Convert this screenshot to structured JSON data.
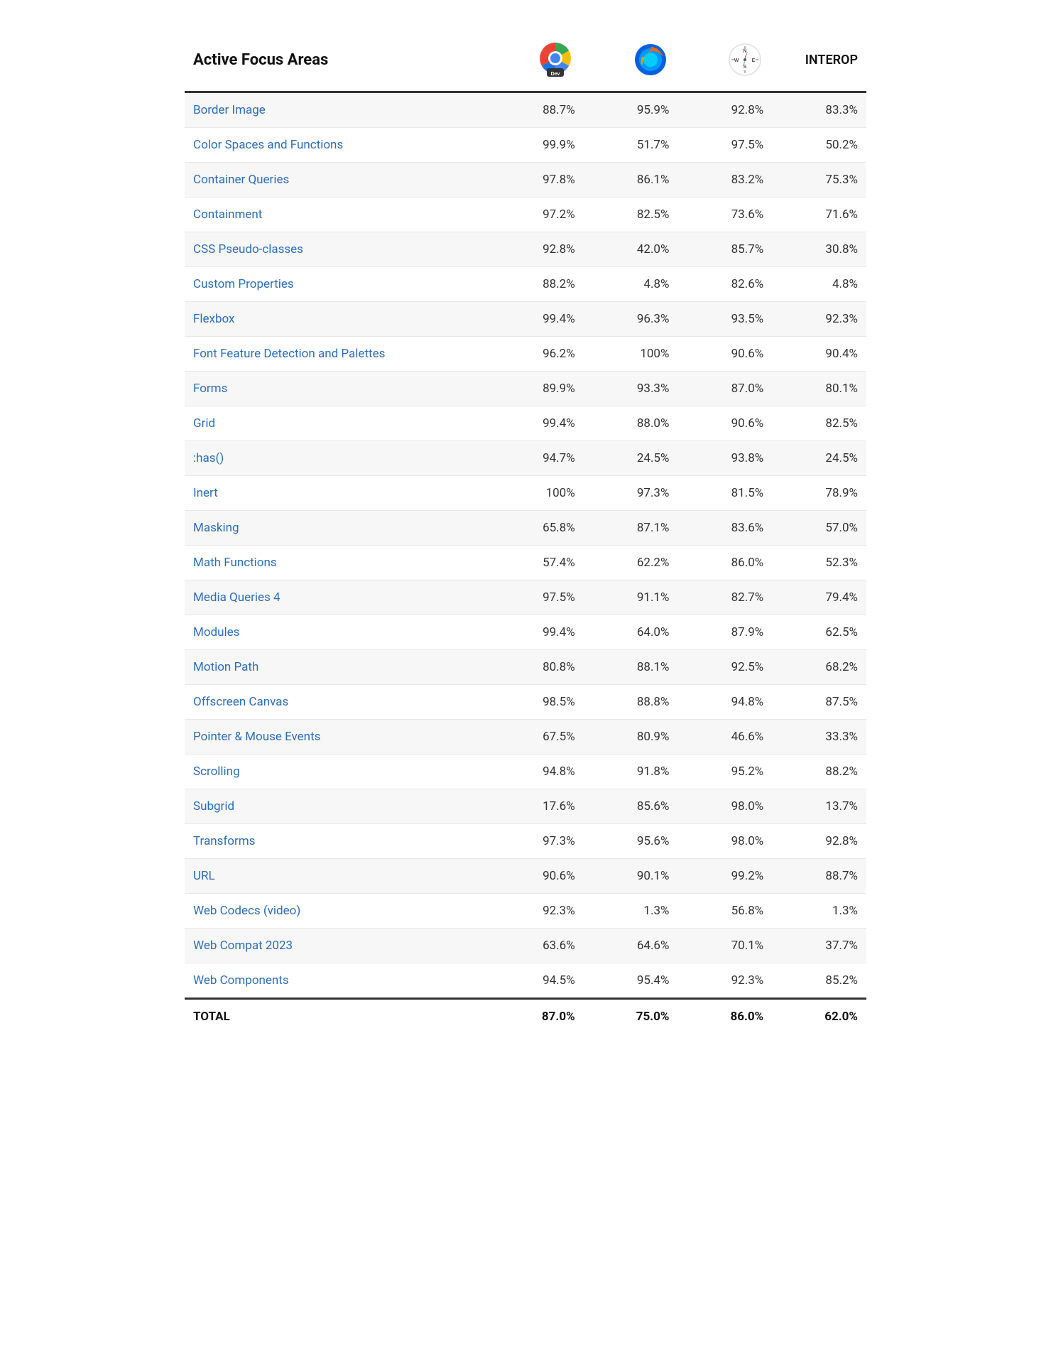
{
  "header": {
    "area_label": "Active Focus Areas",
    "interop_label": "INTEROP"
  },
  "browsers": {
    "chrome_dev_label": "Chrome Dev",
    "firefox_label": "Firefox",
    "safari_label": "Safari"
  },
  "rows": [
    {
      "name": "Border Image",
      "chrome": "88.7%",
      "firefox": "95.9%",
      "safari": "92.8%",
      "interop": "83.3%"
    },
    {
      "name": "Color Spaces and Functions",
      "chrome": "99.9%",
      "firefox": "51.7%",
      "safari": "97.5%",
      "interop": "50.2%"
    },
    {
      "name": "Container Queries",
      "chrome": "97.8%",
      "firefox": "86.1%",
      "safari": "83.2%",
      "interop": "75.3%"
    },
    {
      "name": "Containment",
      "chrome": "97.2%",
      "firefox": "82.5%",
      "safari": "73.6%",
      "interop": "71.6%"
    },
    {
      "name": "CSS Pseudo-classes",
      "chrome": "92.8%",
      "firefox": "42.0%",
      "safari": "85.7%",
      "interop": "30.8%"
    },
    {
      "name": "Custom Properties",
      "chrome": "88.2%",
      "firefox": "4.8%",
      "safari": "82.6%",
      "interop": "4.8%"
    },
    {
      "name": "Flexbox",
      "chrome": "99.4%",
      "firefox": "96.3%",
      "safari": "93.5%",
      "interop": "92.3%"
    },
    {
      "name": "Font Feature Detection and Palettes",
      "chrome": "96.2%",
      "firefox": "100%",
      "safari": "90.6%",
      "interop": "90.4%"
    },
    {
      "name": "Forms",
      "chrome": "89.9%",
      "firefox": "93.3%",
      "safari": "87.0%",
      "interop": "80.1%"
    },
    {
      "name": "Grid",
      "chrome": "99.4%",
      "firefox": "88.0%",
      "safari": "90.6%",
      "interop": "82.5%"
    },
    {
      "name": ":has()",
      "chrome": "94.7%",
      "firefox": "24.5%",
      "safari": "93.8%",
      "interop": "24.5%"
    },
    {
      "name": "Inert",
      "chrome": "100%",
      "firefox": "97.3%",
      "safari": "81.5%",
      "interop": "78.9%"
    },
    {
      "name": "Masking",
      "chrome": "65.8%",
      "firefox": "87.1%",
      "safari": "83.6%",
      "interop": "57.0%"
    },
    {
      "name": "Math Functions",
      "chrome": "57.4%",
      "firefox": "62.2%",
      "safari": "86.0%",
      "interop": "52.3%"
    },
    {
      "name": "Media Queries 4",
      "chrome": "97.5%",
      "firefox": "91.1%",
      "safari": "82.7%",
      "interop": "79.4%"
    },
    {
      "name": "Modules",
      "chrome": "99.4%",
      "firefox": "64.0%",
      "safari": "87.9%",
      "interop": "62.5%"
    },
    {
      "name": "Motion Path",
      "chrome": "80.8%",
      "firefox": "88.1%",
      "safari": "92.5%",
      "interop": "68.2%"
    },
    {
      "name": "Offscreen Canvas",
      "chrome": "98.5%",
      "firefox": "88.8%",
      "safari": "94.8%",
      "interop": "87.5%"
    },
    {
      "name": "Pointer & Mouse Events",
      "chrome": "67.5%",
      "firefox": "80.9%",
      "safari": "46.6%",
      "interop": "33.3%"
    },
    {
      "name": "Scrolling",
      "chrome": "94.8%",
      "firefox": "91.8%",
      "safari": "95.2%",
      "interop": "88.2%"
    },
    {
      "name": "Subgrid",
      "chrome": "17.6%",
      "firefox": "85.6%",
      "safari": "98.0%",
      "interop": "13.7%"
    },
    {
      "name": "Transforms",
      "chrome": "97.3%",
      "firefox": "95.6%",
      "safari": "98.0%",
      "interop": "92.8%"
    },
    {
      "name": "URL",
      "chrome": "90.6%",
      "firefox": "90.1%",
      "safari": "99.2%",
      "interop": "88.7%"
    },
    {
      "name": "Web Codecs (video)",
      "chrome": "92.3%",
      "firefox": "1.3%",
      "safari": "56.8%",
      "interop": "1.3%"
    },
    {
      "name": "Web Compat 2023",
      "chrome": "63.6%",
      "firefox": "64.6%",
      "safari": "70.1%",
      "interop": "37.7%"
    },
    {
      "name": "Web Components",
      "chrome": "94.5%",
      "firefox": "95.4%",
      "safari": "92.3%",
      "interop": "85.2%"
    }
  ],
  "totals": {
    "label": "TOTAL",
    "chrome": "87.0%",
    "firefox": "75.0%",
    "safari": "86.0%",
    "interop": "62.0%"
  }
}
